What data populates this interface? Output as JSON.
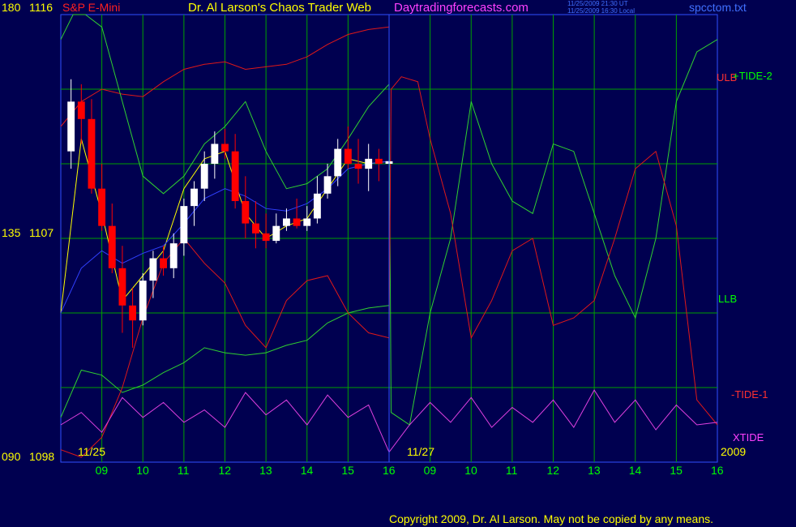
{
  "header": {
    "symbol": "S&P E-Mini",
    "title": "Dr. Al Larson's Chaos Trader Web",
    "site": "Daytradingforecasts.com",
    "stamp_ut": "11/25/2009 21:30 UT",
    "stamp_local": "11/25/2009 16:30 Local",
    "filename": "spcctom.txt"
  },
  "axis": {
    "left_top": "180",
    "right_top": "1116",
    "left_mid": "135",
    "right_mid": "1107",
    "left_bot": "090",
    "right_bot": "1098",
    "date1": "11/25",
    "date2": "11/27",
    "year": "2009",
    "hours": [
      "09",
      "10",
      "11",
      "12",
      "13",
      "14",
      "15",
      "16",
      "09",
      "10",
      "11",
      "12",
      "13",
      "14",
      "15",
      "16"
    ]
  },
  "labels": {
    "ulb": "ULB",
    "tide2": "+TIDE-2",
    "llb": "LLB",
    "tide1": "-TIDE-1",
    "xtide": "XTIDE"
  },
  "footer": {
    "copyright": "Copyright 2009, Dr. Al Larson. May not be copied by any means."
  },
  "colors": {
    "background": "#000050",
    "grid": "#00a000",
    "frame": "#3050ff",
    "price_up": "#ffffff",
    "price_down": "#ff0000",
    "series_red": "#e01818",
    "series_green": "#30d030",
    "series_magenta": "#e040e0",
    "ma_yellow": "#ffff00",
    "ma_blue": "#3040ff",
    "labels_yellow": "#ffff00"
  },
  "chart_data": {
    "type": "line",
    "title": "S&P E-Mini",
    "ylim": [
      1098,
      1116
    ],
    "x_units": "hour index (0 = 11/25 08:00 ET, 16 = 11/27 16:00 ET)",
    "price_bars": {
      "x": [
        0.25,
        0.5,
        0.75,
        1.0,
        1.25,
        1.5,
        1.75,
        2.0,
        2.25,
        2.5,
        2.75,
        3.0,
        3.25,
        3.5,
        3.75,
        4.0,
        4.25,
        4.5,
        4.75,
        5.0,
        5.25,
        5.5,
        5.75,
        6.0,
        6.25,
        6.5,
        6.75,
        7.0,
        7.25,
        7.5,
        7.75,
        8.0
      ],
      "open": [
        1110.5,
        1112.5,
        1111.8,
        1109.0,
        1107.5,
        1105.8,
        1104.3,
        1103.7,
        1105.3,
        1106.2,
        1105.8,
        1106.8,
        1108.3,
        1109.0,
        1110.0,
        1110.8,
        1110.5,
        1108.5,
        1107.6,
        1107.2,
        1106.9,
        1107.5,
        1107.8,
        1107.5,
        1107.8,
        1108.8,
        1109.5,
        1110.6,
        1110.0,
        1109.8,
        1110.2,
        1110.0
      ],
      "high": [
        1113.4,
        1113.2,
        1112.6,
        1110.0,
        1108.4,
        1106.7,
        1105.0,
        1105.6,
        1106.5,
        1106.7,
        1107.2,
        1108.6,
        1109.3,
        1110.5,
        1111.3,
        1111.4,
        1111.2,
        1109.5,
        1108.5,
        1108.0,
        1108.0,
        1108.2,
        1108.6,
        1108.3,
        1109.5,
        1110.0,
        1111.0,
        1111.5,
        1111.0,
        1110.8,
        1110.6,
        1110.5
      ],
      "low": [
        1109.8,
        1110.8,
        1108.8,
        1107.3,
        1105.6,
        1103.2,
        1102.6,
        1103.5,
        1104.6,
        1105.5,
        1105.4,
        1106.3,
        1107.5,
        1108.5,
        1109.4,
        1110.2,
        1108.2,
        1107.0,
        1106.6,
        1106.6,
        1106.8,
        1107.3,
        1107.4,
        1107.3,
        1107.6,
        1108.6,
        1109.1,
        1109.8,
        1109.2,
        1108.9,
        1109.3,
        1109.5
      ],
      "close": [
        1112.5,
        1111.8,
        1109.0,
        1107.5,
        1105.8,
        1104.3,
        1103.7,
        1105.3,
        1106.2,
        1105.8,
        1106.8,
        1108.3,
        1109.0,
        1110.0,
        1110.8,
        1110.5,
        1108.5,
        1107.6,
        1107.2,
        1106.9,
        1107.5,
        1107.8,
        1107.5,
        1107.8,
        1108.8,
        1109.5,
        1110.6,
        1110.0,
        1109.8,
        1110.2,
        1110.0,
        1110.1
      ]
    },
    "series": [
      {
        "name": "ULB",
        "color": "#e01818",
        "x": [
          0,
          0.5,
          1,
          1.5,
          2,
          2.5,
          3,
          3.5,
          4,
          4.5,
          5,
          5.5,
          6,
          6.5,
          7,
          7.5,
          8
        ],
        "y": [
          1111.5,
          1112.5,
          1113.0,
          1112.8,
          1112.7,
          1113.3,
          1113.8,
          1114.0,
          1114.1,
          1113.8,
          1113.9,
          1114.0,
          1114.3,
          1114.8,
          1115.2,
          1115.4,
          1115.5
        ]
      },
      {
        "name": "LLB",
        "color": "#30d030",
        "x": [
          0,
          0.5,
          1,
          1.5,
          2,
          2.5,
          3,
          3.5,
          4,
          4.5,
          5,
          5.5,
          6,
          6.5,
          7,
          7.5,
          8
        ],
        "y": [
          1099.8,
          1101.7,
          1101.5,
          1100.8,
          1101.1,
          1101.6,
          1102.0,
          1102.6,
          1102.4,
          1102.3,
          1102.4,
          1102.7,
          1102.9,
          1103.6,
          1104.0,
          1104.2,
          1104.3
        ]
      },
      {
        "name": "+TIDE-2",
        "color": "#30d030",
        "x": [
          0,
          0.3,
          0.6,
          1,
          1.5,
          2,
          2.5,
          3,
          3.5,
          4,
          4.5,
          5,
          5.5,
          6,
          6.5,
          7,
          7.5,
          8,
          8.05,
          8.5,
          9,
          9.5,
          10,
          10.5,
          11,
          11.5,
          12,
          12.5,
          13,
          13.5,
          14,
          14.5,
          15,
          15.5,
          16
        ],
        "y": [
          1115.0,
          1116.0,
          1116.0,
          1115.5,
          1112.5,
          1109.5,
          1108.8,
          1109.5,
          1110.8,
          1111.5,
          1112.5,
          1110.5,
          1109.0,
          1109.2,
          1109.8,
          1111.0,
          1112.3,
          1113.2,
          1100.0,
          1099.5,
          1104.0,
          1107.0,
          1112.5,
          1110.0,
          1108.5,
          1108.0,
          1110.8,
          1110.5,
          1108.0,
          1105.5,
          1103.8,
          1107.0,
          1112.5,
          1114.5,
          1115.0
        ]
      },
      {
        "name": "-TIDE-1",
        "color": "#e01818",
        "x": [
          0,
          0.5,
          1,
          1.5,
          2,
          2.5,
          3,
          3.5,
          4,
          4.5,
          5,
          5.5,
          6,
          6.5,
          7,
          7.5,
          8,
          8.05,
          8.3,
          8.7,
          9,
          9.5,
          10,
          10.5,
          11,
          11.5,
          12,
          12.5,
          13,
          13.5,
          14,
          14.5,
          15,
          15.5,
          16
        ],
        "y": [
          1098.5,
          1098.2,
          1099.0,
          1101.0,
          1103.8,
          1106.0,
          1107.0,
          1106.0,
          1105.2,
          1103.5,
          1102.6,
          1104.5,
          1105.3,
          1105.5,
          1104.0,
          1103.2,
          1103.0,
          1113.0,
          1113.5,
          1113.3,
          1111.0,
          1108.0,
          1103.0,
          1104.5,
          1106.5,
          1107.0,
          1103.5,
          1103.8,
          1104.5,
          1107.0,
          1109.8,
          1110.5,
          1107.5,
          1100.5,
          1099.5
        ]
      },
      {
        "name": "XTIDE",
        "color": "#e040e0",
        "x": [
          0,
          0.5,
          1,
          1.5,
          2,
          2.5,
          3,
          3.5,
          4,
          4.5,
          5,
          5.5,
          6,
          6.5,
          7,
          7.5,
          8,
          8.5,
          9,
          9.5,
          10,
          10.5,
          11,
          11.5,
          12,
          12.5,
          13,
          13.5,
          14,
          14.5,
          15,
          15.5,
          16
        ],
        "y": [
          1099.5,
          1100.0,
          1099.2,
          1100.6,
          1099.8,
          1100.4,
          1099.6,
          1100.1,
          1099.4,
          1100.8,
          1099.9,
          1100.5,
          1099.5,
          1100.7,
          1099.8,
          1100.3,
          1098.4,
          1099.5,
          1100.4,
          1099.6,
          1100.6,
          1099.4,
          1100.2,
          1099.6,
          1100.5,
          1099.4,
          1100.9,
          1099.6,
          1100.5,
          1099.3,
          1100.3,
          1099.5,
          1099.6
        ]
      },
      {
        "name": "short MA",
        "color": "#ffff00",
        "x": [
          0,
          0.5,
          1,
          1.5,
          2,
          2.5,
          3,
          3.5,
          4,
          4.5,
          5,
          5.5,
          6,
          6.5,
          7,
          7.5,
          8
        ],
        "y": [
          1104.0,
          1111.0,
          1108.0,
          1104.5,
          1105.5,
          1106.5,
          1109.0,
          1110.2,
          1110.5,
          1108.0,
          1107.0,
          1107.5,
          1107.8,
          1109.0,
          1110.2,
          1110.0,
          1110.1
        ]
      },
      {
        "name": "long MA",
        "color": "#3040ff",
        "x": [
          0,
          0.5,
          1,
          1.5,
          2,
          2.5,
          3,
          3.5,
          4,
          4.5,
          5,
          5.5,
          6,
          6.5,
          7,
          7.5,
          8
        ],
        "y": [
          1104.0,
          1105.8,
          1106.5,
          1106.0,
          1106.4,
          1106.7,
          1107.6,
          1108.6,
          1109.0,
          1108.7,
          1108.2,
          1108.1,
          1108.4,
          1109.0,
          1109.8,
          1110.0,
          1110.1
        ]
      }
    ]
  }
}
